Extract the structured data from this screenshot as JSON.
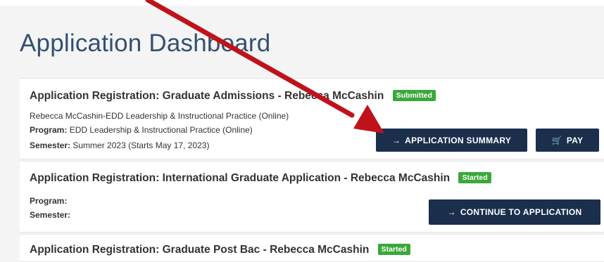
{
  "page": {
    "title": "Application Dashboard"
  },
  "applications": [
    {
      "label": "Application Registration:",
      "name": "Graduate Admissions - Rebecca McCashin",
      "status": "Submitted",
      "description": "Rebecca McCashin-EDD Leadership & Instructional Practice (Online)",
      "program_label": "Program:",
      "program": "EDD Leadership & Instructional Practice (Online)",
      "semester_label": "Semester:",
      "semester": "Summer 2023 (Starts May 17, 2023)",
      "buttons": [
        {
          "icon": "→",
          "label": "APPLICATION SUMMARY"
        },
        {
          "icon": "🛒",
          "label": "PAY"
        }
      ]
    },
    {
      "label": "Application Registration:",
      "name": "International Graduate Application - Rebecca McCashin",
      "status": "Started",
      "program_label": "Program:",
      "semester_label": "Semester:",
      "buttons": [
        {
          "icon": "→",
          "label": "CONTINUE TO APPLICATION"
        }
      ]
    },
    {
      "label": "Application Registration:",
      "name": "Graduate Post Bac - Rebecca McCashin",
      "status": "Started"
    }
  ],
  "annotation": {
    "arrow_color": "#c0121b"
  },
  "colors": {
    "primary_button": "#1b2f4d",
    "badge_green": "#3aa83a",
    "title_blue": "#35506f"
  }
}
